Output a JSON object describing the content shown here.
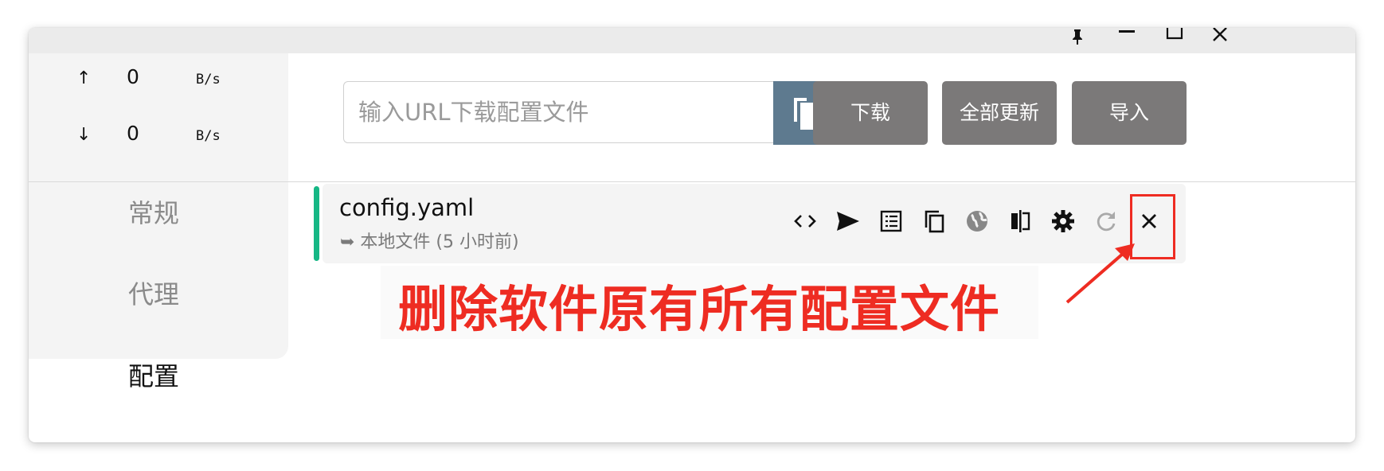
{
  "window_controls": {
    "pin": "pin-icon",
    "minimize": "minimize-icon",
    "maximize": "maximize-icon",
    "close": "close-icon"
  },
  "traffic": {
    "up": {
      "arrow": "↑",
      "value": "0",
      "unit": "B/s"
    },
    "down": {
      "arrow": "↓",
      "value": "0",
      "unit": "B/s"
    }
  },
  "nav": {
    "items": [
      {
        "label": "常规"
      },
      {
        "label": "代理"
      },
      {
        "label": "配置"
      }
    ],
    "active_index": 2
  },
  "url_input": {
    "placeholder": "输入URL下载配置文件",
    "value": ""
  },
  "buttons": {
    "paste": "paste-icon",
    "download": "下载",
    "update_all": "全部更新",
    "import": "导入"
  },
  "profile": {
    "name": "config.yaml",
    "meta": "➥ 本地文件 (5 小时前)",
    "accent_color": "#16b785",
    "actions": [
      "code-icon",
      "send-icon",
      "list-icon",
      "copy-icon",
      "globe-icon",
      "split-icon",
      "gear-icon",
      "refresh-icon",
      "close-icon"
    ]
  },
  "annotation": {
    "text": "删除软件原有所有配置文件",
    "color": "#ee2c22"
  },
  "colors": {
    "paste_button": "#5e7a8f",
    "gray_button": "#7b7979",
    "sidebar_bg": "#f4f4f4"
  }
}
